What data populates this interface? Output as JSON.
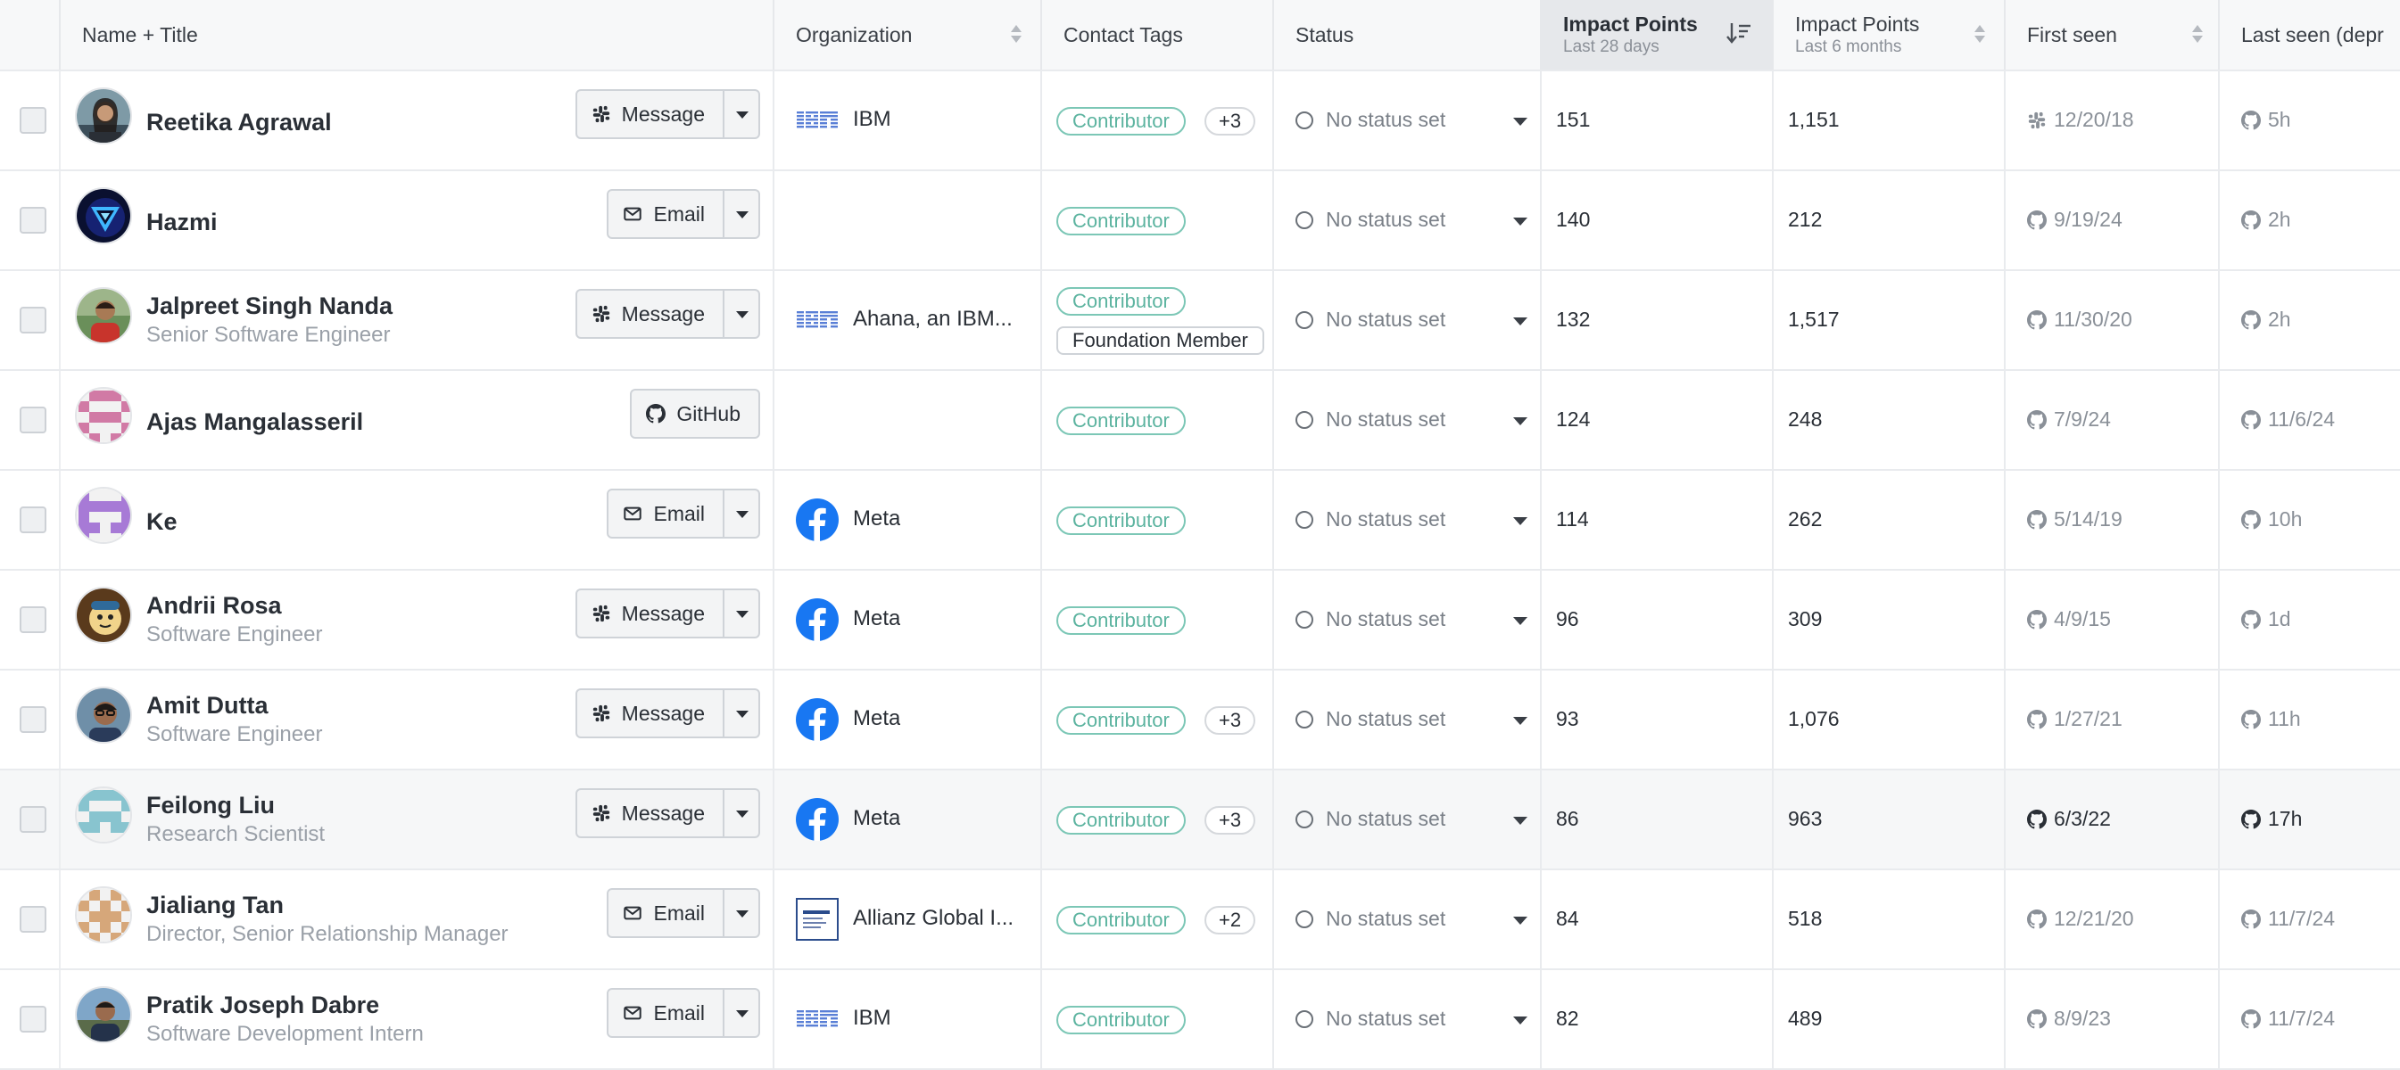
{
  "columns": {
    "name": "Name + Title",
    "organization": "Organization",
    "contact_tags": "Contact Tags",
    "status": "Status",
    "impact_28": {
      "title": "Impact Points",
      "sub": "Last 28 days"
    },
    "impact_6m": {
      "title": "Impact Points",
      "sub": "Last 6 months"
    },
    "first_seen": "First seen",
    "last_seen": "Last seen (depr"
  },
  "colors": {
    "tag_accent": "#5bb39f",
    "header_bg": "#f7f8f9",
    "sorted_header_bg": "#e6e8eb",
    "facebook_blue": "#1877f2",
    "ibm_blue": "#5a7fd6"
  },
  "rows": [
    {
      "name": "Reetika Agrawal",
      "title": "",
      "avatar": "photo-woman",
      "action": {
        "label": "Message",
        "icon": "slack-icon",
        "has_dropdown": true
      },
      "org": {
        "name": "IBM",
        "logo": "ibm-logo"
      },
      "tags": [
        "Contributor"
      ],
      "more": "+3",
      "status": "No status set",
      "impact28": "151",
      "impact6m": "1,151",
      "first_seen": "12/20/18",
      "first_icon": "slack-icon",
      "last_seen": "5h",
      "last_icon": "github-icon"
    },
    {
      "name": "Hazmi",
      "title": "",
      "avatar": "photo-triangle",
      "action": {
        "label": "Email",
        "icon": "mail-icon",
        "has_dropdown": true
      },
      "org": {
        "name": "",
        "logo": ""
      },
      "tags": [
        "Contributor"
      ],
      "more": "",
      "status": "No status set",
      "impact28": "140",
      "impact6m": "212",
      "first_seen": "9/19/24",
      "first_icon": "github-icon",
      "last_seen": "2h",
      "last_icon": "github-icon"
    },
    {
      "name": "Jalpreet Singh Nanda",
      "title": "Senior Software Engineer",
      "avatar": "photo-man-red",
      "action": {
        "label": "Message",
        "icon": "slack-icon",
        "has_dropdown": true
      },
      "org": {
        "name": "Ahana, an IBM...",
        "logo": "ibm-logo"
      },
      "tags": [
        "Contributor",
        "Foundation Member"
      ],
      "more": "",
      "status": "No status set",
      "impact28": "132",
      "impact6m": "1,517",
      "first_seen": "11/30/20",
      "first_icon": "github-icon",
      "last_seen": "2h",
      "last_icon": "github-icon"
    },
    {
      "name": "Ajas Mangalasseril",
      "title": "",
      "avatar": "identicon-pink",
      "action": {
        "label": "GitHub",
        "icon": "github-icon",
        "has_dropdown": false
      },
      "org": {
        "name": "",
        "logo": ""
      },
      "tags": [
        "Contributor"
      ],
      "more": "",
      "status": "No status set",
      "impact28": "124",
      "impact6m": "248",
      "first_seen": "7/9/24",
      "first_icon": "github-icon",
      "last_seen": "11/6/24",
      "last_icon": "github-icon"
    },
    {
      "name": "Ke",
      "title": "",
      "avatar": "identicon-purple",
      "action": {
        "label": "Email",
        "icon": "mail-icon",
        "has_dropdown": true
      },
      "org": {
        "name": "Meta",
        "logo": "facebook-logo"
      },
      "tags": [
        "Contributor"
      ],
      "more": "",
      "status": "No status set",
      "impact28": "114",
      "impact6m": "262",
      "first_seen": "5/14/19",
      "first_icon": "github-icon",
      "last_seen": "10h",
      "last_icon": "github-icon"
    },
    {
      "name": "Andrii Rosa",
      "title": "Software Engineer",
      "avatar": "photo-cartoon",
      "action": {
        "label": "Message",
        "icon": "slack-icon",
        "has_dropdown": true
      },
      "org": {
        "name": "Meta",
        "logo": "facebook-logo"
      },
      "tags": [
        "Contributor"
      ],
      "more": "",
      "status": "No status set",
      "impact28": "96",
      "impact6m": "309",
      "first_seen": "4/9/15",
      "first_icon": "github-icon",
      "last_seen": "1d",
      "last_icon": "github-icon"
    },
    {
      "name": "Amit Dutta",
      "title": "Software Engineer",
      "avatar": "photo-man-glasses",
      "action": {
        "label": "Message",
        "icon": "slack-icon",
        "has_dropdown": true
      },
      "org": {
        "name": "Meta",
        "logo": "facebook-logo"
      },
      "tags": [
        "Contributor"
      ],
      "more": "+3",
      "status": "No status set",
      "impact28": "93",
      "impact6m": "1,076",
      "first_seen": "1/27/21",
      "first_icon": "github-icon",
      "last_seen": "11h",
      "last_icon": "github-icon"
    },
    {
      "name": "Feilong Liu",
      "title": "Research Scientist",
      "avatar": "identicon-teal",
      "action": {
        "label": "Message",
        "icon": "slack-icon",
        "has_dropdown": true
      },
      "org": {
        "name": "Meta",
        "logo": "facebook-logo"
      },
      "tags": [
        "Contributor"
      ],
      "more": "+3",
      "status": "No status set",
      "impact28": "86",
      "impact6m": "963",
      "first_seen": "6/3/22",
      "first_icon": "github-icon",
      "last_seen": "17h",
      "last_icon": "github-icon",
      "highlighted": true
    },
    {
      "name": "Jialiang Tan",
      "title": "Director, Senior Relationship Manager",
      "avatar": "identicon-orange",
      "action": {
        "label": "Email",
        "icon": "mail-icon",
        "has_dropdown": true
      },
      "org": {
        "name": "Allianz Global I...",
        "logo": "allianz-logo"
      },
      "tags": [
        "Contributor"
      ],
      "more": "+2",
      "status": "No status set",
      "impact28": "84",
      "impact6m": "518",
      "first_seen": "12/21/20",
      "first_icon": "github-icon",
      "last_seen": "11/7/24",
      "last_icon": "github-icon"
    },
    {
      "name": "Pratik Joseph Dabre",
      "title": "Software Development Intern",
      "avatar": "photo-man-outdoor",
      "action": {
        "label": "Email",
        "icon": "mail-icon",
        "has_dropdown": true
      },
      "org": {
        "name": "IBM",
        "logo": "ibm-logo"
      },
      "tags": [
        "Contributor"
      ],
      "more": "",
      "status": "No status set",
      "impact28": "82",
      "impact6m": "489",
      "first_seen": "8/9/23",
      "first_icon": "github-icon",
      "last_seen": "11/7/24",
      "last_icon": "github-icon"
    }
  ]
}
